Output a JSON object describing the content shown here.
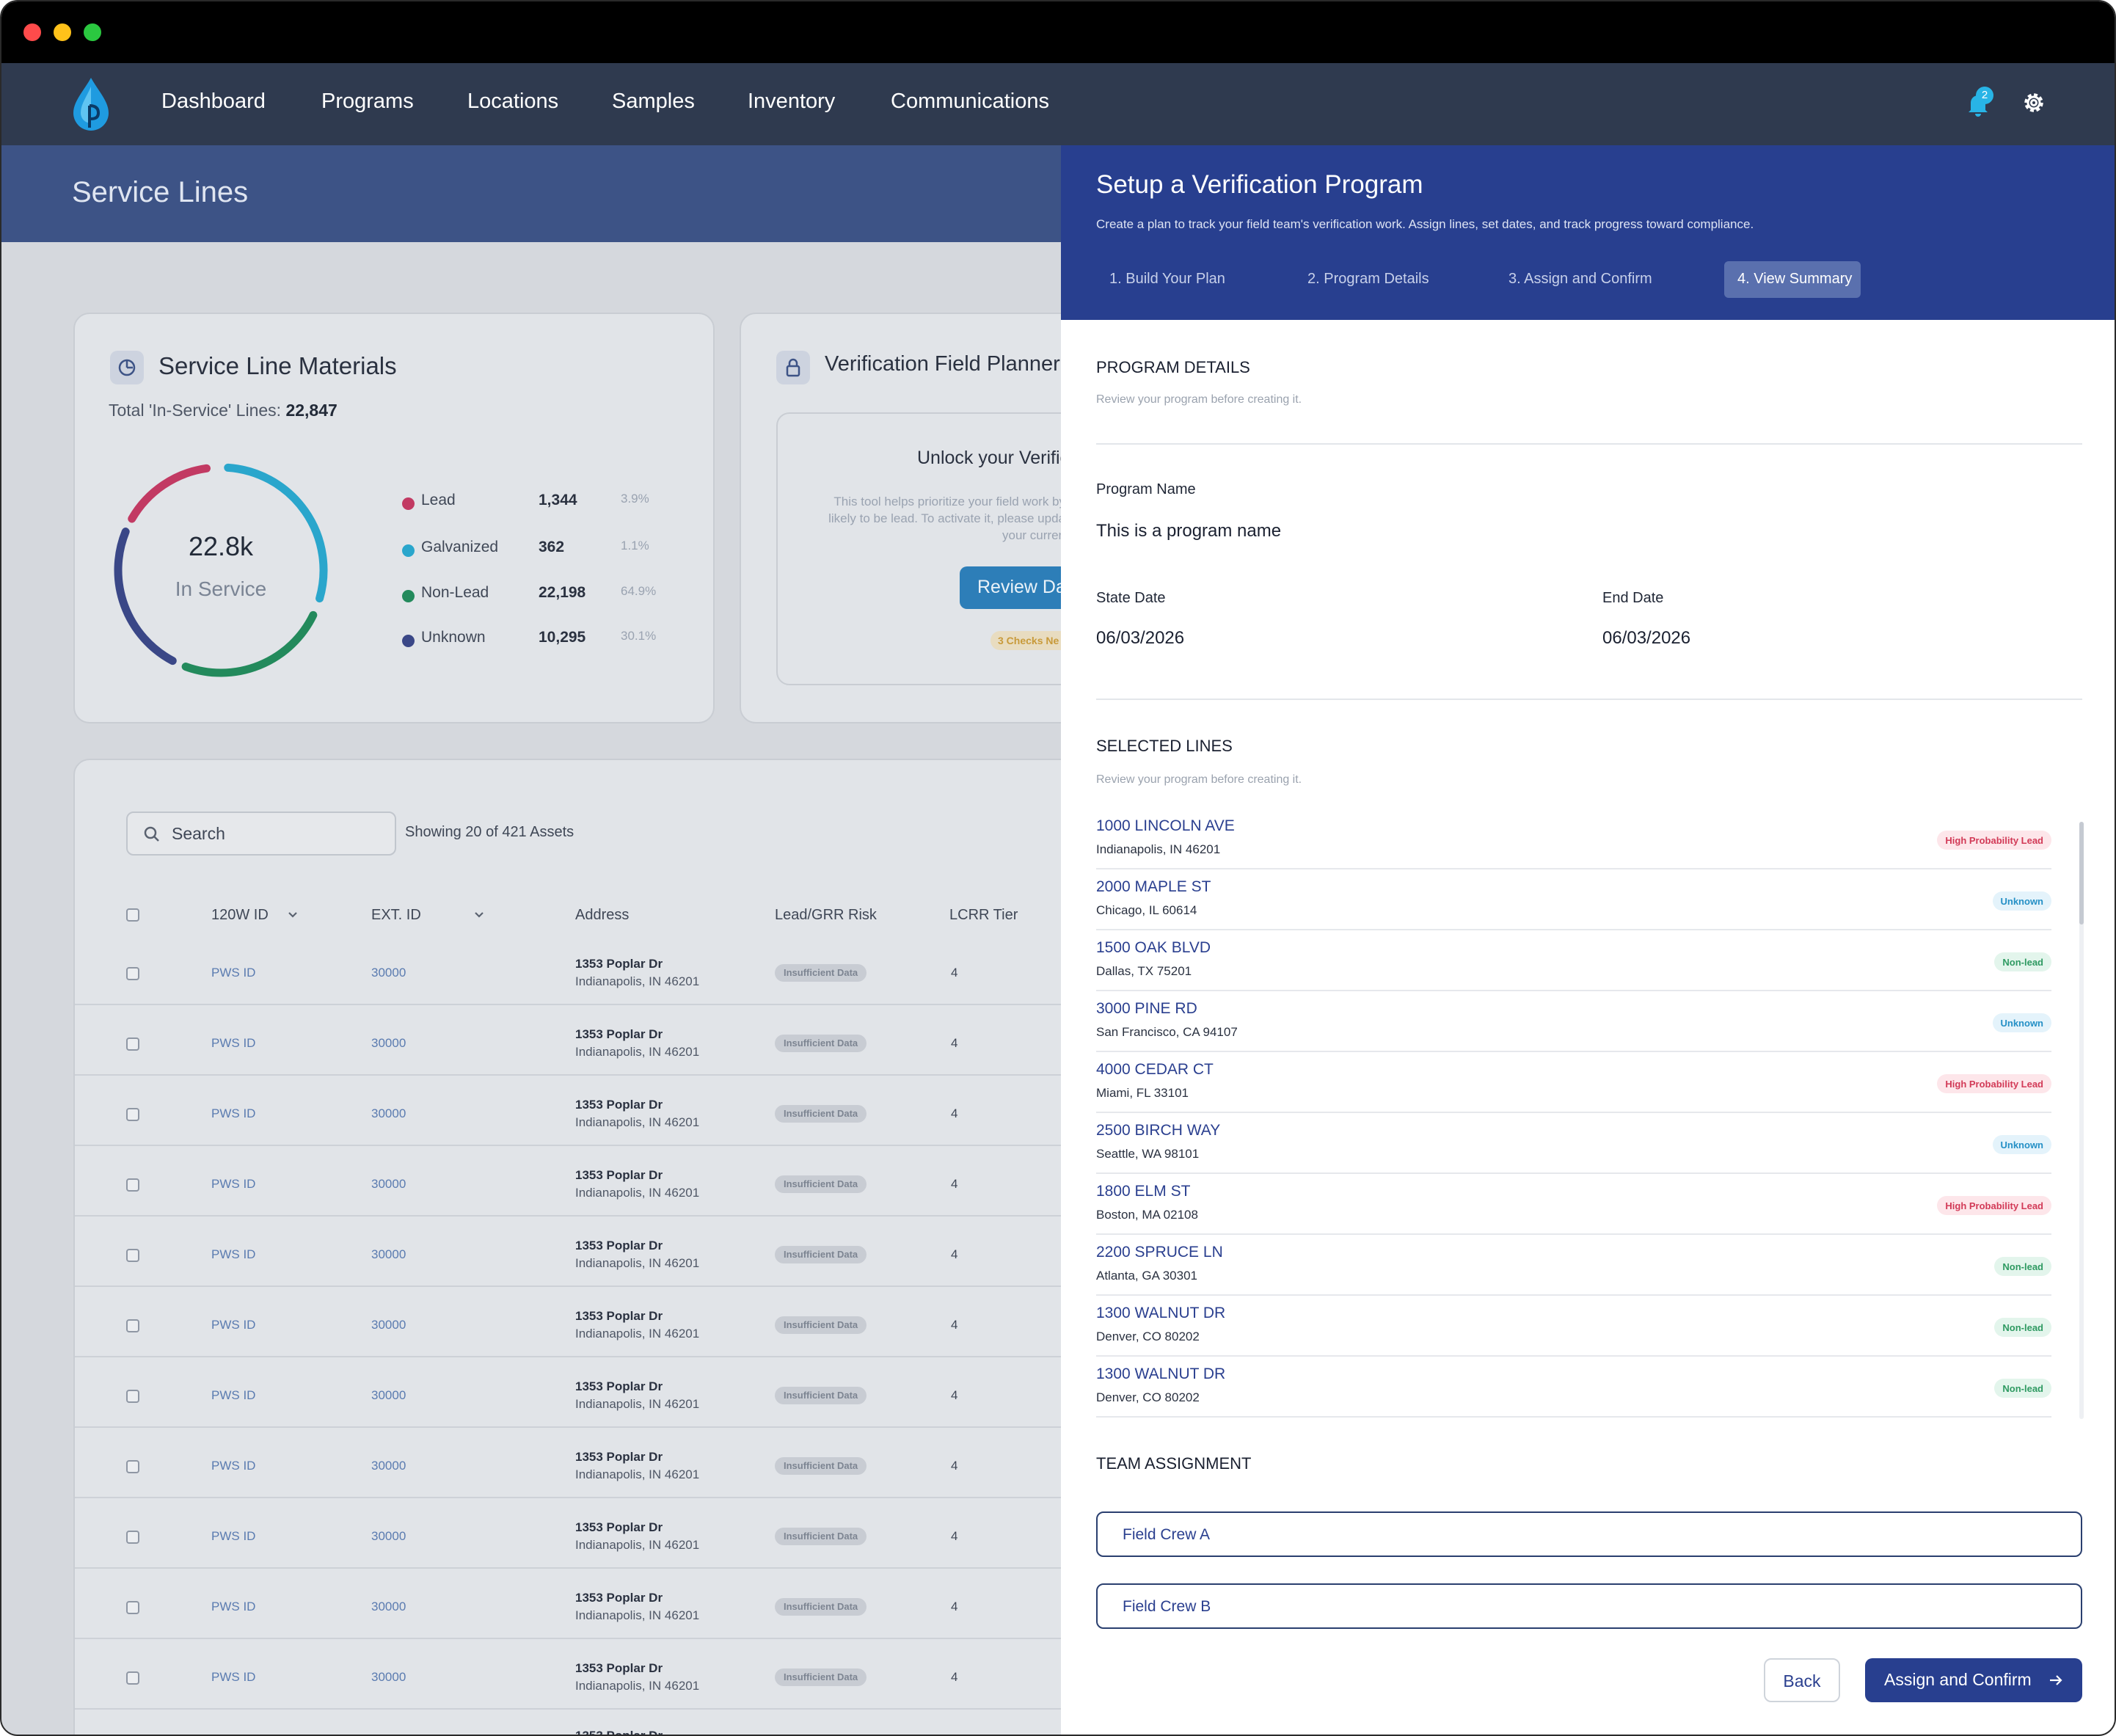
{
  "nav": {
    "items": [
      "Dashboard",
      "Programs",
      "Locations",
      "Samples",
      "Inventory",
      "Communications"
    ],
    "notification_count": "2"
  },
  "page": {
    "title": "Service Lines"
  },
  "materials": {
    "title": "Service Line Materials",
    "total_label": "Total 'In-Service' Lines:",
    "total_value": "22,847",
    "center_value": "22.8k",
    "center_label": "In Service",
    "legend": [
      {
        "name": "Lead",
        "value": "1,344",
        "pct": "3.9%",
        "color": "#c23a63"
      },
      {
        "name": "Galvanized",
        "value": "362",
        "pct": "1.1%",
        "color": "#2aa6cc"
      },
      {
        "name": "Non-Lead",
        "value": "22,198",
        "pct": "64.9%",
        "color": "#238a5c"
      },
      {
        "name": "Unknown",
        "value": "10,295",
        "pct": "30.1%",
        "color": "#3a4787"
      }
    ]
  },
  "planner": {
    "title": "Verification Field Planner",
    "unlock_title": "Unlock your Verific",
    "unlock_text": "This tool helps prioritize your field work by likely to be lead. To activate it, please upda your curren",
    "review_label": "Review Da",
    "checks_label": "3 Checks Ne"
  },
  "table": {
    "search_placeholder": "Search",
    "showing": "Showing 20 of 421 Assets",
    "headers": [
      "120W ID",
      "EXT. ID",
      "Address",
      "Lead/GRR Risk",
      "LCRR Tier"
    ],
    "rows": [
      {
        "pws": "PWS ID",
        "ext": "30000",
        "addr1": "1353 Poplar Dr",
        "addr2": "Indianapolis, IN 46201",
        "risk": "Insufficient Data",
        "tier": "4"
      },
      {
        "pws": "PWS ID",
        "ext": "30000",
        "addr1": "1353 Poplar Dr",
        "addr2": "Indianapolis, IN 46201",
        "risk": "Insufficient Data",
        "tier": "4"
      },
      {
        "pws": "PWS ID",
        "ext": "30000",
        "addr1": "1353 Poplar Dr",
        "addr2": "Indianapolis, IN 46201",
        "risk": "Insufficient Data",
        "tier": "4"
      },
      {
        "pws": "PWS ID",
        "ext": "30000",
        "addr1": "1353 Poplar Dr",
        "addr2": "Indianapolis, IN 46201",
        "risk": "Insufficient Data",
        "tier": "4"
      },
      {
        "pws": "PWS ID",
        "ext": "30000",
        "addr1": "1353 Poplar Dr",
        "addr2": "Indianapolis, IN 46201",
        "risk": "Insufficient Data",
        "tier": "4"
      },
      {
        "pws": "PWS ID",
        "ext": "30000",
        "addr1": "1353 Poplar Dr",
        "addr2": "Indianapolis, IN 46201",
        "risk": "Insufficient Data",
        "tier": "4"
      },
      {
        "pws": "PWS ID",
        "ext": "30000",
        "addr1": "1353 Poplar Dr",
        "addr2": "Indianapolis, IN 46201",
        "risk": "Insufficient Data",
        "tier": "4"
      },
      {
        "pws": "PWS ID",
        "ext": "30000",
        "addr1": "1353 Poplar Dr",
        "addr2": "Indianapolis, IN 46201",
        "risk": "Insufficient Data",
        "tier": "4"
      },
      {
        "pws": "PWS ID",
        "ext": "30000",
        "addr1": "1353 Poplar Dr",
        "addr2": "Indianapolis, IN 46201",
        "risk": "Insufficient Data",
        "tier": "4"
      },
      {
        "pws": "PWS ID",
        "ext": "30000",
        "addr1": "1353 Poplar Dr",
        "addr2": "Indianapolis, IN 46201",
        "risk": "Insufficient Data",
        "tier": "4"
      },
      {
        "pws": "PWS ID",
        "ext": "30000",
        "addr1": "1353 Poplar Dr",
        "addr2": "Indianapolis, IN 46201",
        "risk": "Insufficient Data",
        "tier": "4"
      }
    ],
    "partial_row_addr": "1353 Poplar Dr"
  },
  "panel": {
    "title": "Setup a Verification Program",
    "subtitle": "Create a plan to track your field team's verification work. Assign lines, set dates, and track progress toward compliance.",
    "steps": [
      "1. Build Your Plan",
      "2. Program Details",
      "3. Assign and Confirm",
      "4. View Summary"
    ],
    "active_step": "4. View Summary",
    "program_details": {
      "title": "PROGRAM DETAILS",
      "subtitle": "Review your program before creating it.",
      "name_label": "Program Name",
      "name_value": "This is a program name",
      "start_label": "State Date",
      "start_value": "06/03/2026",
      "end_label": "End Date",
      "end_value": "06/03/2026"
    },
    "selected_lines": {
      "title": "SELECTED LINES",
      "subtitle": "Review your program before creating it.",
      "lines": [
        {
          "street": "1000 LINCOLN AVE",
          "city": "Indianapolis, IN 46201",
          "tag": "High Probability Lead",
          "kind": "hpl"
        },
        {
          "street": "2000 MAPLE ST",
          "city": "Chicago, IL 60614",
          "tag": "Unknown",
          "kind": "unk"
        },
        {
          "street": "1500 OAK BLVD",
          "city": "Dallas, TX 75201",
          "tag": "Non-lead",
          "kind": "nl"
        },
        {
          "street": "3000 PINE RD",
          "city": "San Francisco, CA 94107",
          "tag": "Unknown",
          "kind": "unk"
        },
        {
          "street": "4000 CEDAR CT",
          "city": "Miami, FL 33101",
          "tag": "High Probability Lead",
          "kind": "hpl"
        },
        {
          "street": "2500 BIRCH WAY",
          "city": "Seattle, WA 98101",
          "tag": "Unknown",
          "kind": "unk"
        },
        {
          "street": "1800 ELM ST",
          "city": "Boston, MA 02108",
          "tag": "High Probability Lead",
          "kind": "hpl"
        },
        {
          "street": "2200 SPRUCE LN",
          "city": "Atlanta, GA 30301",
          "tag": "Non-lead",
          "kind": "nl"
        },
        {
          "street": "1300 WALNUT DR",
          "city": "Denver, CO 80202",
          "tag": "Non-lead",
          "kind": "nl"
        },
        {
          "street": "1300 WALNUT DR",
          "city": "Denver, CO 80202",
          "tag": "Non-lead",
          "kind": "nl"
        }
      ]
    },
    "team": {
      "title": "TEAM ASSIGNMENT",
      "crews": [
        "Field Crew A",
        "Field Crew B"
      ]
    },
    "back_label": "Back",
    "assign_label": "Assign and Confirm"
  }
}
